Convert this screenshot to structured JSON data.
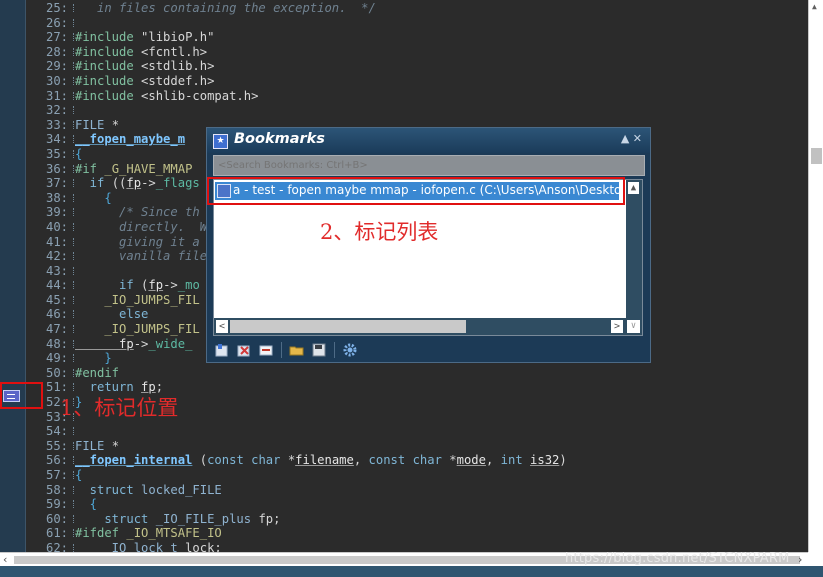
{
  "editor": {
    "lines": [
      {
        "n": "25:",
        "segs": [
          [
            "t-com",
            "   in files containing the exception.  */"
          ]
        ]
      },
      {
        "n": "26:",
        "segs": []
      },
      {
        "n": "27:",
        "segs": [
          [
            "t-pp",
            "#include "
          ],
          [
            "t-str",
            "\"libioP.h\""
          ]
        ]
      },
      {
        "n": "28:",
        "segs": [
          [
            "t-pp",
            "#include "
          ],
          [
            "t-str",
            "<fcntl.h>"
          ]
        ]
      },
      {
        "n": "29:",
        "segs": [
          [
            "t-pp",
            "#include "
          ],
          [
            "t-str",
            "<stdlib.h>"
          ]
        ]
      },
      {
        "n": "30:",
        "segs": [
          [
            "t-pp",
            "#include "
          ],
          [
            "t-str",
            "<stddef.h>"
          ]
        ]
      },
      {
        "n": "31:",
        "segs": [
          [
            "t-pp",
            "#include "
          ],
          [
            "t-str",
            "<shlib-compat.h>"
          ]
        ]
      },
      {
        "n": "32:",
        "segs": []
      },
      {
        "n": "33:",
        "segs": [
          [
            "t-ty",
            "FILE "
          ],
          [
            "t-id",
            "*"
          ]
        ]
      },
      {
        "n": "34:",
        "segs": [
          [
            "t-fn",
            "__fopen_maybe_m"
          ]
        ]
      },
      {
        "n": "35:",
        "segs": [
          [
            "t-br",
            "{"
          ]
        ]
      },
      {
        "n": "36:",
        "segs": [
          [
            "t-pp",
            "#if "
          ],
          [
            "t-mac",
            "_G_HAVE_MMAP"
          ]
        ]
      },
      {
        "n": "37:",
        "segs": [
          [
            "t-kw",
            "  if "
          ],
          [
            "t-id",
            "(("
          ],
          [
            "t-par",
            "fp"
          ],
          [
            "t-id",
            "->"
          ],
          [
            "t-mem",
            "_flags"
          ]
        ]
      },
      {
        "n": "38:",
        "segs": [
          [
            "t-br",
            "    {"
          ]
        ]
      },
      {
        "n": "39:",
        "segs": [
          [
            "t-com",
            "      /* Since th"
          ]
        ]
      },
      {
        "n": "40:",
        "segs": [
          [
            "t-com",
            "      directly.  W"
          ]
        ]
      },
      {
        "n": "41:",
        "segs": [
          [
            "t-com",
            "      giving it a "
          ]
        ]
      },
      {
        "n": "42:",
        "segs": [
          [
            "t-com",
            "      vanilla file"
          ]
        ]
      },
      {
        "n": "43:",
        "segs": []
      },
      {
        "n": "44:",
        "segs": [
          [
            "t-kw",
            "      if "
          ],
          [
            "t-id",
            "("
          ],
          [
            "t-par",
            "fp"
          ],
          [
            "t-id",
            "->"
          ],
          [
            "t-mem",
            "_mo"
          ]
        ]
      },
      {
        "n": "45:",
        "segs": [
          [
            "t-mac",
            "    _IO_JUMPS_FIL"
          ]
        ]
      },
      {
        "n": "46:",
        "segs": [
          [
            "t-kw",
            "      else"
          ]
        ]
      },
      {
        "n": "47:",
        "segs": [
          [
            "t-mac",
            "    _IO_JUMPS_FIL"
          ]
        ]
      },
      {
        "n": "48:",
        "segs": [
          [
            "t-par",
            "      fp"
          ],
          [
            "t-id",
            "->"
          ],
          [
            "t-mem",
            "_wide_"
          ]
        ]
      },
      {
        "n": "49:",
        "segs": [
          [
            "t-br",
            "    }"
          ]
        ]
      },
      {
        "n": "50:",
        "segs": [
          [
            "t-pp",
            "#endif"
          ]
        ]
      },
      {
        "n": "51:",
        "segs": [
          [
            "t-kw",
            "  return "
          ],
          [
            "t-par",
            "fp"
          ],
          [
            "t-id",
            ";"
          ]
        ]
      },
      {
        "n": "52:",
        "segs": [
          [
            "t-br",
            "}"
          ]
        ]
      },
      {
        "n": "53:",
        "segs": []
      },
      {
        "n": "54:",
        "segs": []
      },
      {
        "n": "55:",
        "segs": [
          [
            "t-ty",
            "FILE "
          ],
          [
            "t-id",
            "*"
          ]
        ]
      },
      {
        "n": "56:",
        "segs": [
          [
            "t-fn",
            "__fopen_internal"
          ],
          [
            "t-id",
            " ("
          ],
          [
            "t-kw",
            "const char "
          ],
          [
            "t-id",
            "*"
          ],
          [
            "t-par",
            "filename"
          ],
          [
            "t-id",
            ", "
          ],
          [
            "t-kw",
            "const char "
          ],
          [
            "t-id",
            "*"
          ],
          [
            "t-par",
            "mode"
          ],
          [
            "t-id",
            ", "
          ],
          [
            "t-kw",
            "int "
          ],
          [
            "t-par",
            "is32"
          ],
          [
            "t-id",
            ")"
          ]
        ]
      },
      {
        "n": "57:",
        "segs": [
          [
            "t-br",
            "{"
          ]
        ]
      },
      {
        "n": "58:",
        "segs": [
          [
            "t-kw",
            "  struct "
          ],
          [
            "t-ty",
            "locked_FILE"
          ]
        ]
      },
      {
        "n": "59:",
        "segs": [
          [
            "t-br",
            "  {"
          ]
        ]
      },
      {
        "n": "60:",
        "segs": [
          [
            "t-kw",
            "    struct "
          ],
          [
            "t-ty",
            "_IO_FILE_plus "
          ],
          [
            "t-id",
            "fp;"
          ]
        ]
      },
      {
        "n": "61:",
        "segs": [
          [
            "t-pp",
            "#ifdef "
          ],
          [
            "t-mac",
            "_IO_MTSAFE_IO"
          ]
        ]
      },
      {
        "n": "62:",
        "segs": [
          [
            "t-ty",
            "    _IO_lock_t "
          ],
          [
            "t-id",
            "lock;"
          ]
        ]
      }
    ]
  },
  "annotations": {
    "mark_position": "1、标记位置",
    "mark_list": "2、标记列表"
  },
  "bookmarks": {
    "title": "Bookmarks",
    "title_controls": "▲ ✕",
    "search_placeholder": "<Search Bookmarks: Ctrl+B>",
    "items": [
      {
        "label": "a - test -    fopen  maybe  mmap - iofopen.c (C:\\Users\\Anson\\Deskto"
      }
    ]
  },
  "watermark": "https://blog.csdn.net/STCNXPARM",
  "colors": {
    "editor_bg": "#2b2b2b",
    "gutter_bg": "#243b4f",
    "annotation_red": "#e01010",
    "selection": "#3a88d2"
  }
}
